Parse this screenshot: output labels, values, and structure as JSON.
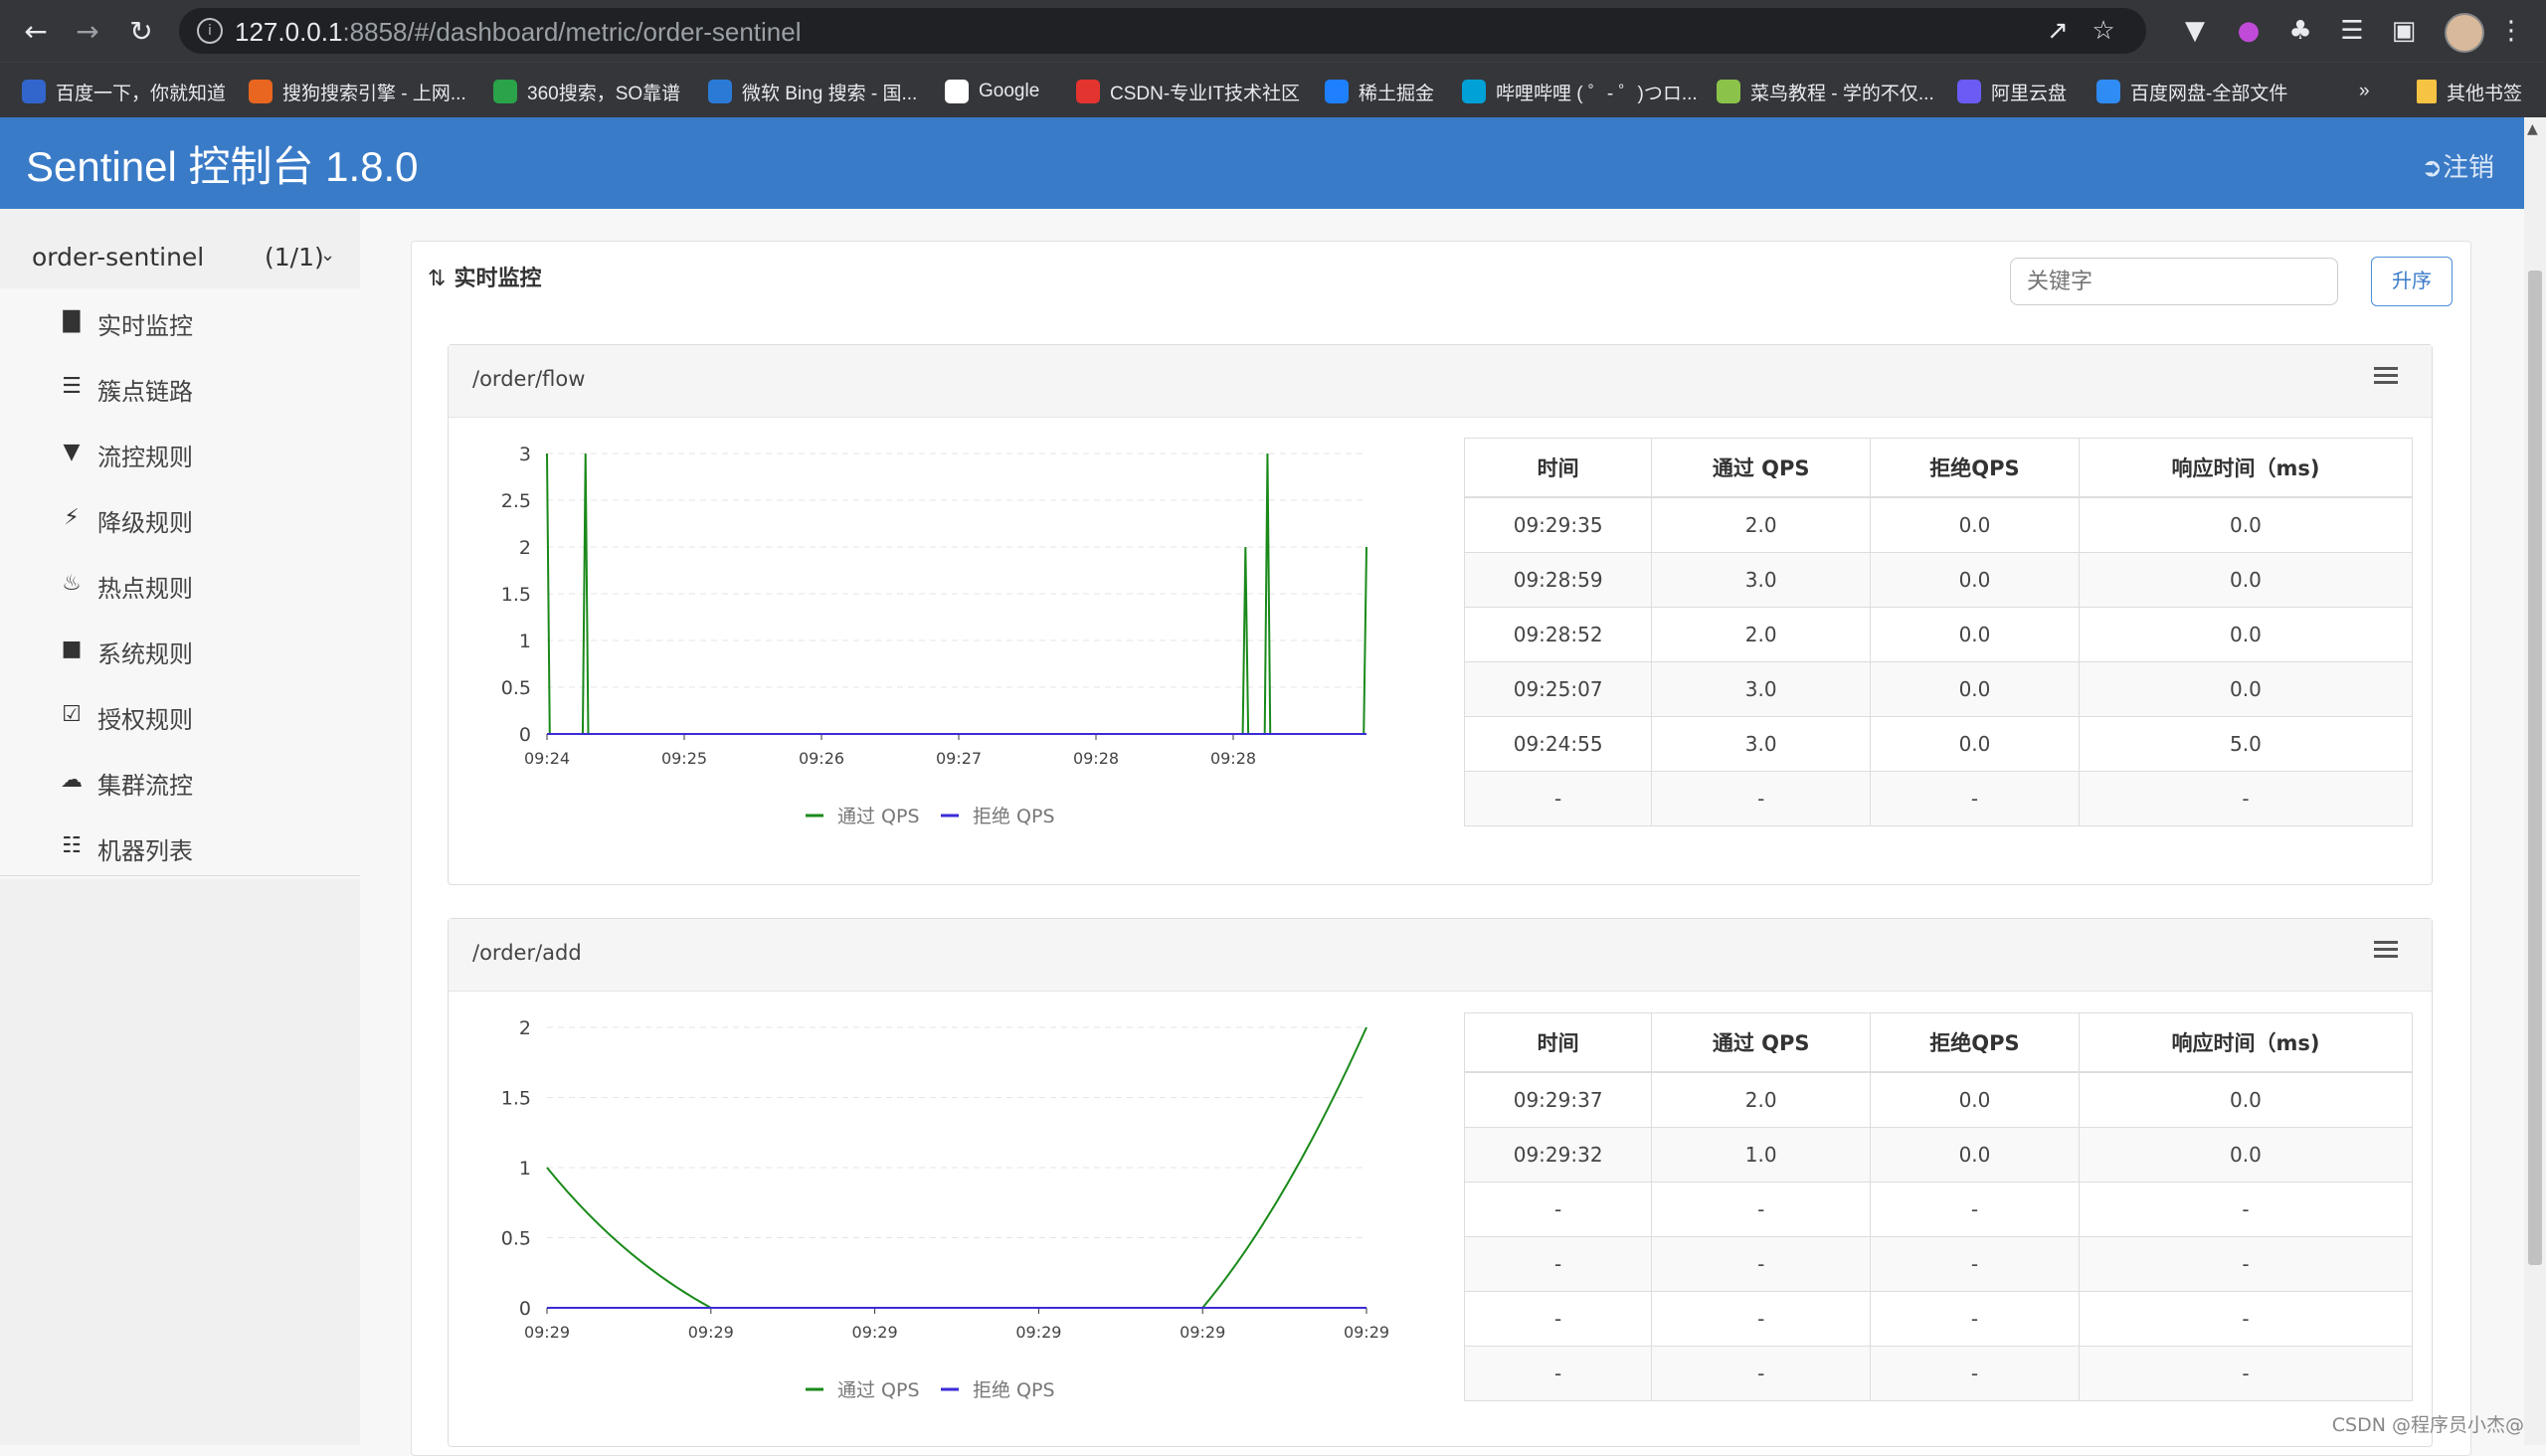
{
  "browser": {
    "url_host": "127.0.0.1",
    "url_rest": ":8858/#/dashboard/metric/order-sentinel",
    "bookmarks": [
      {
        "label": "百度一下，你就知道",
        "color": "#3366cc",
        "icon": "baidu-icon"
      },
      {
        "label": "搜狗搜索引擎 - 上网...",
        "color": "#e8661f",
        "icon": "sogou-icon"
      },
      {
        "label": "360搜索，SO靠谱",
        "color": "#2aa34a",
        "icon": "so360-icon"
      },
      {
        "label": "微软 Bing 搜索 - 国...",
        "color": "#2b7bd6",
        "icon": "bing-icon"
      },
      {
        "label": "Google",
        "color": "#ffffff",
        "icon": "google-icon"
      },
      {
        "label": "CSDN-专业IT技术社区",
        "color": "#e3342f",
        "icon": "csdn-icon"
      },
      {
        "label": "稀土掘金",
        "color": "#1e80ff",
        "icon": "juejin-icon"
      },
      {
        "label": "哔哩哔哩 ( ゜- ゜)つロ...",
        "color": "#00a1d6",
        "icon": "bilibili-icon"
      },
      {
        "label": "菜鸟教程 - 学的不仅...",
        "color": "#8bc34a",
        "icon": "runoob-icon"
      },
      {
        "label": "阿里云盘",
        "color": "#6b5cf6",
        "icon": "aliyun-drive-icon"
      },
      {
        "label": "百度网盘-全部文件",
        "color": "#2f8cf4",
        "icon": "baidu-pan-icon"
      }
    ],
    "more_label": "»",
    "other_bookmarks": "其他书签"
  },
  "app": {
    "title": "Sentinel 控制台 1.8.0",
    "logout": "注销",
    "app_name": "order-sentinel",
    "app_count": "(1/1)"
  },
  "menu": [
    {
      "label": "实时监控",
      "icon": "bar-chart-icon"
    },
    {
      "label": "簇点链路",
      "icon": "list-icon"
    },
    {
      "label": "流控规则",
      "icon": "filter-icon"
    },
    {
      "label": "降级规则",
      "icon": "flash-icon"
    },
    {
      "label": "热点规则",
      "icon": "fire-icon"
    },
    {
      "label": "系统规则",
      "icon": "lock-icon"
    },
    {
      "label": "授权规则",
      "icon": "check-icon"
    },
    {
      "label": "集群流控",
      "icon": "cloud-icon"
    },
    {
      "label": "机器列表",
      "icon": "th-list-icon"
    }
  ],
  "monitor": {
    "title": "实时监控",
    "search_placeholder": "关键字",
    "sort_label": "升序"
  },
  "table_headers": [
    "时间",
    "通过 QPS",
    "拒绝QPS",
    "响应时间（ms)"
  ],
  "resources": [
    {
      "name": "/order/flow",
      "rows": [
        [
          "09:29:35",
          "2.0",
          "0.0",
          "0.0"
        ],
        [
          "09:28:59",
          "3.0",
          "0.0",
          "0.0"
        ],
        [
          "09:28:52",
          "2.0",
          "0.0",
          "0.0"
        ],
        [
          "09:25:07",
          "3.0",
          "0.0",
          "0.0"
        ],
        [
          "09:24:55",
          "3.0",
          "0.0",
          "5.0"
        ],
        [
          "-",
          "-",
          "-",
          "-"
        ]
      ]
    },
    {
      "name": "/order/add",
      "rows": [
        [
          "09:29:37",
          "2.0",
          "0.0",
          "0.0"
        ],
        [
          "09:29:32",
          "1.0",
          "0.0",
          "0.0"
        ],
        [
          "-",
          "-",
          "-",
          "-"
        ],
        [
          "-",
          "-",
          "-",
          "-"
        ],
        [
          "-",
          "-",
          "-",
          "-"
        ],
        [
          "-",
          "-",
          "-",
          "-"
        ]
      ]
    }
  ],
  "chart_data": [
    {
      "type": "line",
      "xticks": [
        "09:24",
        "09:25",
        "09:26",
        "09:27",
        "09:28",
        "09:28"
      ],
      "ylim": [
        0,
        3
      ],
      "yticks": [
        "0",
        "0.5",
        "1",
        "1.5",
        "2",
        "2.5",
        "3"
      ],
      "grid": true,
      "legend_position": "bottom",
      "series": [
        {
          "name": "通过 QPS",
          "color": "#1a8a1a",
          "points": [
            [
              0,
              3
            ],
            [
              0.1,
              0
            ],
            [
              1.3,
              0
            ],
            [
              1.4,
              3
            ],
            [
              1.5,
              0
            ],
            [
              25.3,
              0
            ],
            [
              25.4,
              2
            ],
            [
              25.5,
              0
            ],
            [
              26.1,
              0
            ],
            [
              26.2,
              3
            ],
            [
              26.3,
              0
            ],
            [
              29.7,
              0
            ],
            [
              29.8,
              2
            ]
          ]
        },
        {
          "name": "拒绝 QPS",
          "color": "#3b2bd6",
          "points": [
            [
              0,
              0
            ],
            [
              29.8,
              0
            ]
          ]
        }
      ],
      "x_max": 29.8
    },
    {
      "type": "line",
      "xticks": [
        "09:29",
        "09:29",
        "09:29",
        "09:29",
        "09:29",
        "09:29"
      ],
      "ylim": [
        0,
        2
      ],
      "yticks": [
        "0",
        "0.5",
        "1",
        "1.5",
        "2"
      ],
      "grid": true,
      "legend_position": "bottom",
      "series": [
        {
          "name": "通过 QPS",
          "color": "#1a8a1a",
          "points": [
            [
              0,
              1
            ],
            [
              1,
              0
            ],
            [
              4,
              0
            ],
            [
              5,
              2
            ]
          ],
          "smooth": true
        },
        {
          "name": "拒绝 QPS",
          "color": "#3b2bd6",
          "points": [
            [
              0,
              0
            ],
            [
              5,
              0
            ]
          ]
        }
      ],
      "x_max": 5
    }
  ],
  "watermark": "CSDN @程序员小杰@"
}
